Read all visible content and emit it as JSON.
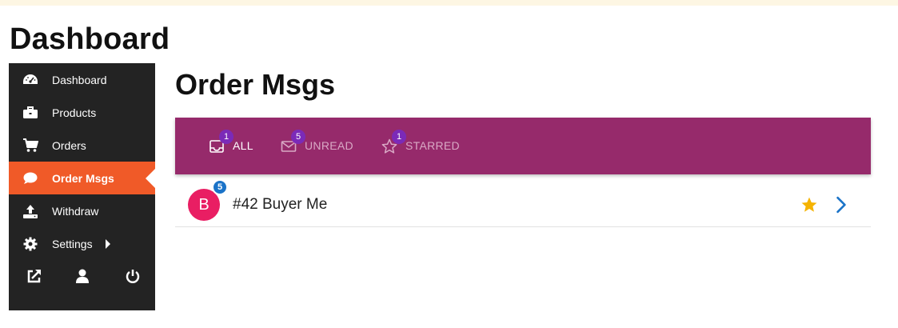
{
  "page": {
    "title": "Dashboard"
  },
  "sidebar": {
    "items": [
      {
        "label": "Dashboard",
        "icon": "speedometer-icon"
      },
      {
        "label": "Products",
        "icon": "briefcase-icon"
      },
      {
        "label": "Orders",
        "icon": "shopping-cart-icon"
      },
      {
        "label": "Order Msgs",
        "icon": "chat-bubble-icon",
        "active": true
      },
      {
        "label": "Withdraw",
        "icon": "upload-icon"
      },
      {
        "label": "Settings",
        "icon": "gear-icon",
        "has_submenu": true
      }
    ],
    "bottom_icons": [
      "external-link-icon",
      "user-icon",
      "power-icon"
    ],
    "colors": {
      "background": "#232323",
      "active": "#f05a28"
    }
  },
  "main": {
    "title": "Order Msgs",
    "tabs": [
      {
        "label": "ALL",
        "badge": "1",
        "icon": "inbox-icon",
        "active": true
      },
      {
        "label": "UNREAD",
        "badge": "5",
        "icon": "envelope-icon",
        "active": false
      },
      {
        "label": "STARRED",
        "badge": "1",
        "icon": "star-outline-icon",
        "active": false
      }
    ],
    "tabbar_color": "#962a6b",
    "messages": [
      {
        "avatar_letter": "B",
        "unread_count": "5",
        "title": "#42 Buyer Me",
        "starred": true,
        "avatar_color": "#e91e63"
      }
    ]
  }
}
